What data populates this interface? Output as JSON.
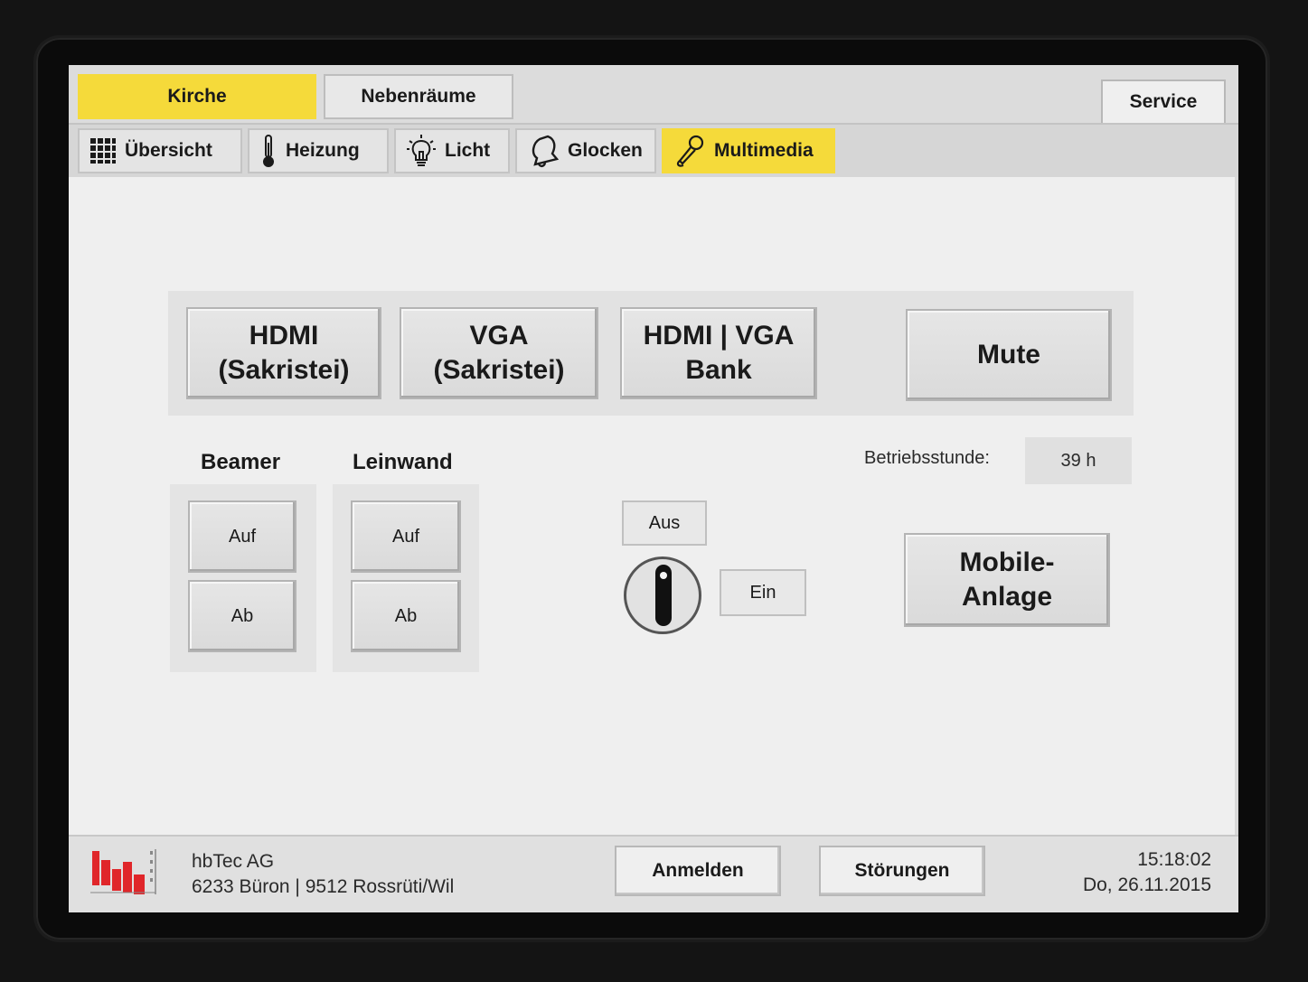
{
  "tabs": {
    "kirche": "Kirche",
    "nebenraeume": "Nebenräume",
    "service": "Service"
  },
  "subtabs": {
    "uebersicht": "Übersicht",
    "heizung": "Heizung",
    "licht": "Licht",
    "glocken": "Glocken",
    "multimedia": "Multimedia"
  },
  "sources": {
    "hdmi_sakristei": [
      "HDMI",
      "(Sakristei)"
    ],
    "vga_sakristei": [
      "VGA",
      "(Sakristei)"
    ],
    "hdmi_vga_bank": [
      "HDMI | VGA",
      "Bank"
    ],
    "mute": "Mute"
  },
  "beamer": {
    "title": "Beamer",
    "up": "Auf",
    "down": "Ab"
  },
  "leinwand": {
    "title": "Leinwand",
    "up": "Auf",
    "down": "Ab"
  },
  "operating_hours": {
    "label": "Betriebsstunde:",
    "value": "39 h"
  },
  "switch": {
    "off": "Aus",
    "on": "Ein"
  },
  "mobile": [
    "Mobile-",
    "Anlage"
  ],
  "footer": {
    "company_name": "hbTec AG",
    "company_address": "6233 Büron | 9512 Rossrüti/Wil",
    "login": "Anmelden",
    "faults": "Störungen",
    "time": "15:18:02",
    "date": "Do, 26.11.2015"
  },
  "colors": {
    "accent": "#f5da3a",
    "logo_red": "#e0262a"
  }
}
